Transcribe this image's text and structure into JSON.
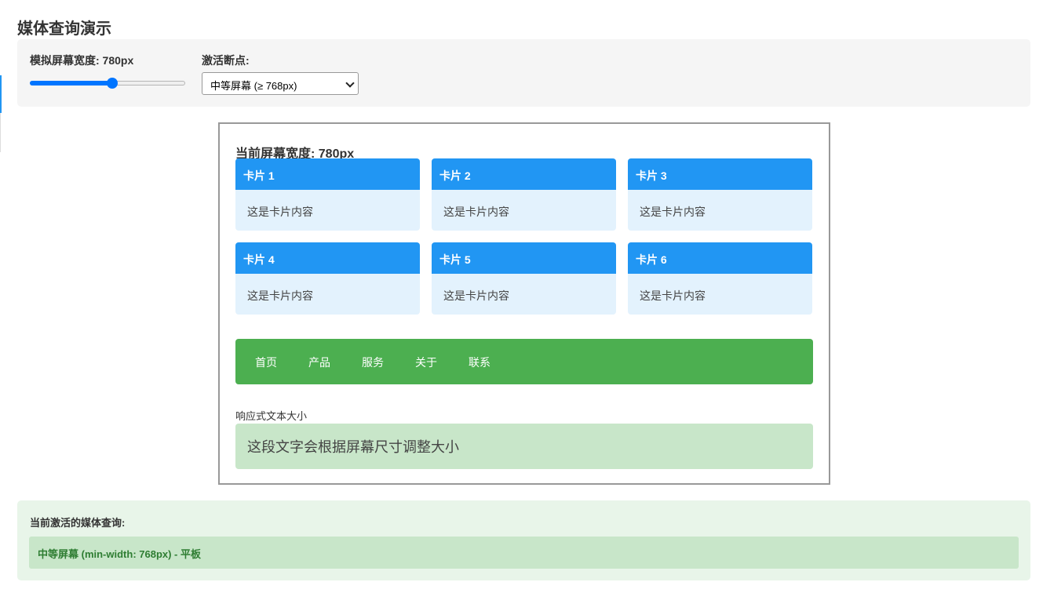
{
  "page": {
    "title": "媒体查询演示"
  },
  "controls": {
    "width_label": "模拟屏幕宽度: 780px",
    "slider": {
      "min": 300,
      "max": 1200,
      "value": 780
    },
    "breakpoint_label": "激活断点:",
    "breakpoint_selected": "中等屏幕 (≥ 768px)"
  },
  "screen": {
    "width_text": "当前屏幕宽度: 780px",
    "cards": [
      {
        "title": "卡片 1",
        "body": "这是卡片内容"
      },
      {
        "title": "卡片 2",
        "body": "这是卡片内容"
      },
      {
        "title": "卡片 3",
        "body": "这是卡片内容"
      },
      {
        "title": "卡片 4",
        "body": "这是卡片内容"
      },
      {
        "title": "卡片 5",
        "body": "这是卡片内容"
      },
      {
        "title": "卡片 6",
        "body": "这是卡片内容"
      }
    ],
    "nav": [
      "首页",
      "产品",
      "服务",
      "关于",
      "联系"
    ],
    "responsive_label": "响应式文本大小",
    "responsive_text": "这段文字会根据屏幕尺寸调整大小"
  },
  "status": {
    "label": "当前激活的媒体查询:",
    "value": "中等屏幕 (min-width: 768px) - 平板"
  },
  "colors": {
    "card_header": "#2196f3",
    "card_body": "#e3f2fd",
    "nav": "#4caf50",
    "responsive_box": "#c8e6c9",
    "status_text": "#2e7d32"
  }
}
